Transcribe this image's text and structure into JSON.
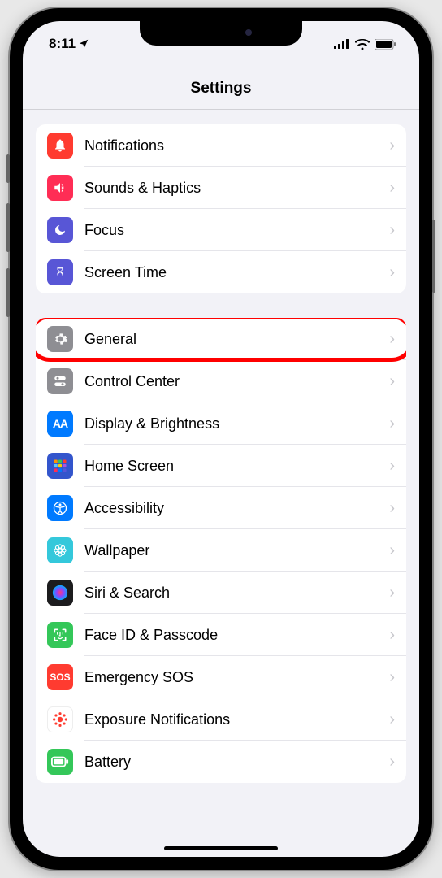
{
  "status": {
    "time": "8:11",
    "location_icon": "location-arrow"
  },
  "header": {
    "title": "Settings"
  },
  "groups": [
    {
      "items": [
        {
          "icon": "bell",
          "bg": "#ff3b30",
          "label": "Notifications"
        },
        {
          "icon": "speaker",
          "bg": "#ff2d55",
          "label": "Sounds & Haptics"
        },
        {
          "icon": "moon",
          "bg": "#5856d6",
          "label": "Focus"
        },
        {
          "icon": "hourglass",
          "bg": "#5856d6",
          "label": "Screen Time"
        }
      ]
    },
    {
      "items": [
        {
          "icon": "gear",
          "bg": "#8e8e93",
          "label": "General",
          "highlight": true
        },
        {
          "icon": "switches",
          "bg": "#8e8e93",
          "label": "Control Center"
        },
        {
          "icon": "text-size",
          "bg": "#007aff",
          "label": "Display & Brightness"
        },
        {
          "icon": "grid",
          "bg": "#3355cc",
          "label": "Home Screen"
        },
        {
          "icon": "accessibility",
          "bg": "#007aff",
          "label": "Accessibility"
        },
        {
          "icon": "flower",
          "bg": "#34c8db",
          "label": "Wallpaper"
        },
        {
          "icon": "siri",
          "bg": "#1c1c1e",
          "label": "Siri & Search"
        },
        {
          "icon": "faceid",
          "bg": "#34c759",
          "label": "Face ID & Passcode"
        },
        {
          "icon": "sos",
          "bg": "#ff3b30",
          "label": "Emergency SOS"
        },
        {
          "icon": "exposure",
          "bg": "#ffffff",
          "label": "Exposure Notifications",
          "fg": "#ff3b30"
        },
        {
          "icon": "battery",
          "bg": "#34c759",
          "label": "Battery"
        }
      ]
    }
  ]
}
